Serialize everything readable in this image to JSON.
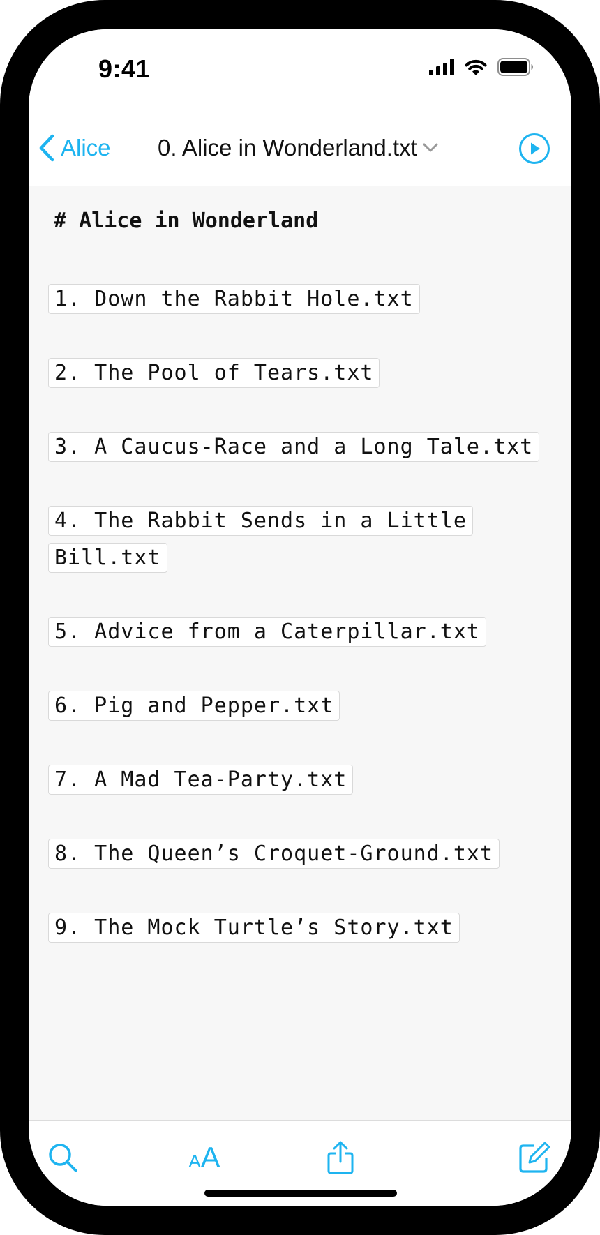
{
  "status_bar": {
    "time": "9:41",
    "icons": [
      "cellular-signal-icon",
      "wifi-icon",
      "battery-icon"
    ]
  },
  "nav": {
    "back_label": "Alice",
    "title": "0. Alice in Wonderland.txt",
    "icons": [
      "chevron-left-icon",
      "chevron-down-icon",
      "play-circle-icon"
    ]
  },
  "document": {
    "heading": "# Alice in Wonderland",
    "links": [
      "1. Down the Rabbit Hole.txt",
      "2. The Pool of Tears.txt",
      "3. A Caucus-Race and a Long Tale.txt",
      "4. The Rabbit Sends in a Little Bill.txt",
      "5. Advice from a Caterpillar.txt",
      "6. Pig and Pepper.txt",
      "7. A Mad Tea-Party.txt",
      "8. The Queen’s Croquet-Ground.txt",
      "9. The Mock Turtle’s Story.txt"
    ]
  },
  "toolbar": {
    "font_icon_text": "AA",
    "icons": [
      "search-icon",
      "font-size-icon",
      "share-icon",
      "compose-icon"
    ]
  },
  "colors": {
    "accent": "#1eb4f0",
    "content_background": "#f7f7f7",
    "text": "#111111"
  }
}
